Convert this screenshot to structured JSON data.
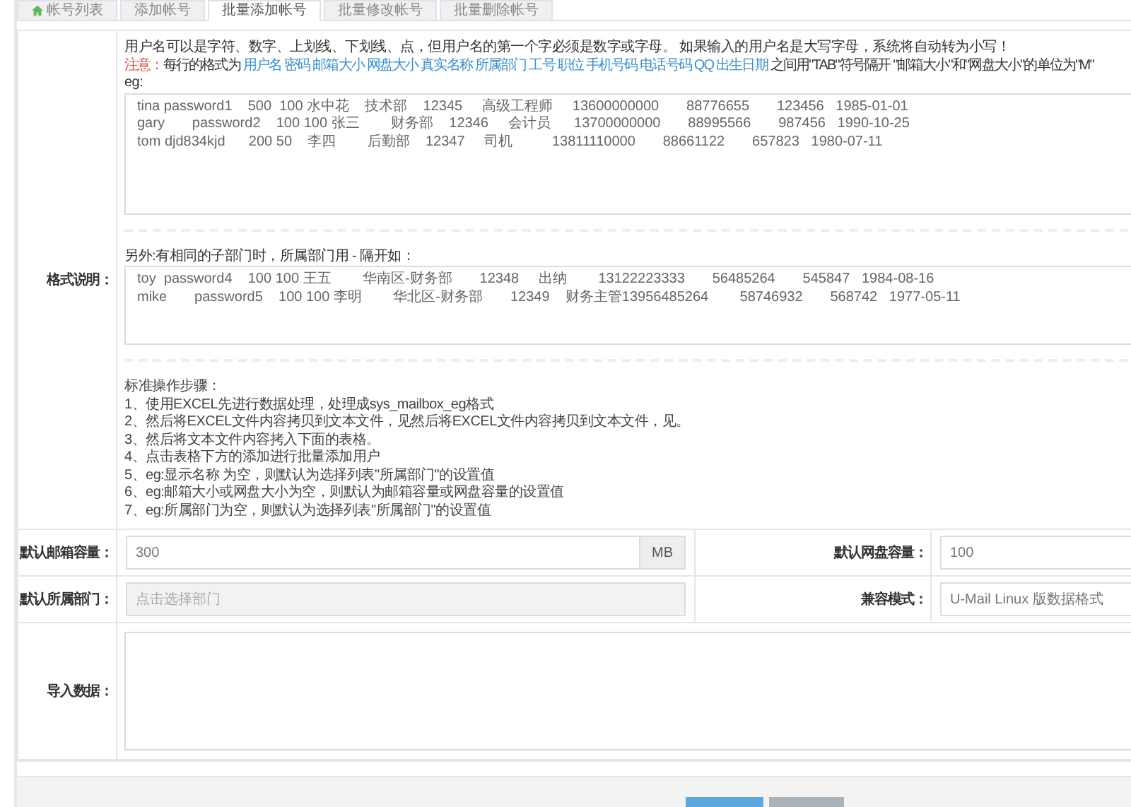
{
  "tabs": [
    {
      "label": "帐号列表",
      "selected": false
    },
    {
      "label": "添加帐号",
      "selected": false
    },
    {
      "label": "批量添加帐号",
      "selected": true
    },
    {
      "label": "批量修改帐号",
      "selected": false
    },
    {
      "label": "批量删除帐号",
      "selected": false
    }
  ],
  "format": {
    "label": "格式说明：",
    "intro": "用户名可以是字符、数字、上划线、下划线、点，但用户名的第一个字必须是数字或字母。 如果输入的用户名是大写字母，系统将自动转为小写！",
    "note_label": "注意：",
    "note_lead": "每行的格式为",
    "note_fields": "用户名 密码 邮箱大小 网盘大小 真实名称 所属部门 工号 职位 手机号码 电话号码 QQ 出生日期",
    "note_tail": "之间用\"TAB\"符号隔开 \"邮箱大小\"和\"网盘大小\"的单位为\"M\"",
    "eg_label": "eg:",
    "example": [
      "tina password1    500  100 水中花    技术部    12345     高级工程师     13600000000       88776655       123456   1985-01-01",
      "gary       password2    100 100 张三        财务部    12346     会计员      13700000000       88995566       987456   1990-10-25",
      "tom djd834kjd      200 50    李四        后勤部    12347     司机          13811110000       88661122       657823   1980-07-11"
    ],
    "sub_note": "另外:有相同的子部门时，所属部门用 - 隔开如：",
    "sub_example": [
      "toy  password4    100 100 王五        华南区-财务部       12348     出纳        13122223333       56485264       545847   1984-08-16",
      "mike       password5    100 100 李明        华北区-财务部       12349    财务主管13956485264        58746932       568742   1977-05-11"
    ],
    "steps_title": "标准操作步骤：",
    "steps": [
      "1、使用EXCEL先进行数据处理，处理成sys_mailbox_eg格式",
      "2、然后将EXCEL文件内容拷贝到文本文件，见然后将EXCEL文件内容拷贝到文本文件，见。",
      "3、然后将文本文件内容拷入下面的表格。",
      "4、点击表格下方的添加进行批量添加用户",
      "5、eg:显示名称 为空，则默认为选择列表\"所属部门\"的设置值",
      "6、eg:邮箱大小或网盘大小为空，则默认为邮箱容量或网盘容量的设置值",
      "7、eg:所属部门为空，则默认为选择列表\"所属部门\"的设置值"
    ]
  },
  "mail_quota": {
    "label": "默认邮箱容量：",
    "value": "300",
    "unit": "MB"
  },
  "disk_quota": {
    "label": "默认网盘容量：",
    "value": "100"
  },
  "department": {
    "label": "默认所属部门：",
    "placeholder": "点击选择部门",
    "disabled": true
  },
  "compat_mode": {
    "label": "兼容模式：",
    "value": "U-Mail Linux 版数据格式"
  },
  "import_data": {
    "label": "导入数据："
  },
  "buttons": [
    {
      "kind": "primary"
    },
    {
      "kind": "secondary"
    }
  ]
}
